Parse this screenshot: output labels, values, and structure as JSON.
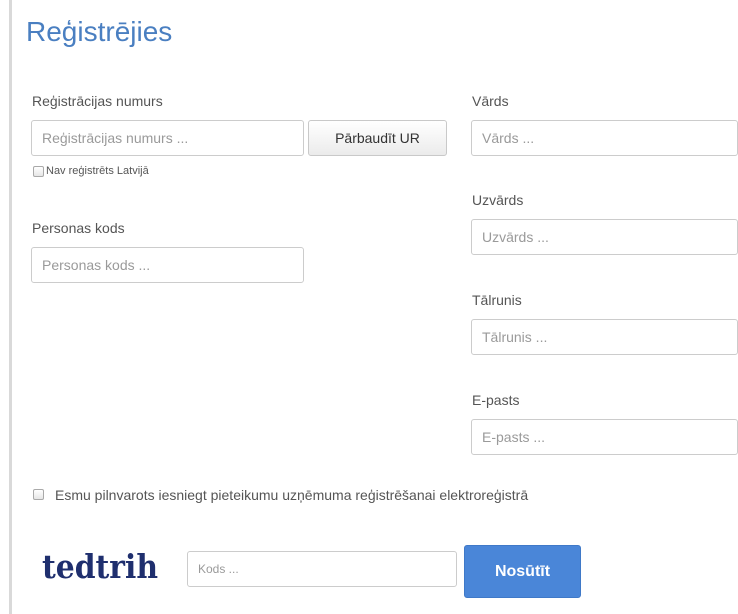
{
  "page": {
    "title": "Reģistrējies"
  },
  "registration_number": {
    "label": "Reģistrācijas numurs",
    "placeholder": "Reģistrācijas numurs ...",
    "check_button_label": "Pārbaudīt UR",
    "not_registered_label": "Nav reģistrēts Latvijā"
  },
  "personal_code": {
    "label": "Personas kods",
    "placeholder": "Personas kods ..."
  },
  "first_name": {
    "label": "Vārds",
    "placeholder": "Vārds ..."
  },
  "last_name": {
    "label": "Uzvārds",
    "placeholder": "Uzvārds ..."
  },
  "phone": {
    "label": "Tālrunis",
    "placeholder": "Tālrunis ..."
  },
  "email": {
    "label": "E-pasts",
    "placeholder": "E-pasts ..."
  },
  "authorization": {
    "label": "Esmu pilnvarots iesniegt pieteikumu uzņēmuma reģistrēšanai elektroreģistrā"
  },
  "captcha": {
    "image_text": "tedtrih",
    "placeholder": "Kods ..."
  },
  "submit": {
    "label": "Nosūtīt"
  },
  "colors": {
    "title": "#4a7fc1",
    "submit_button": "#4a86d8",
    "captcha_text": "#1f2f6e"
  }
}
